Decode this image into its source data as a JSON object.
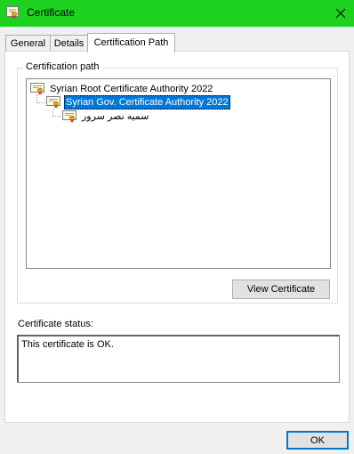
{
  "window": {
    "title": "Certificate",
    "title_bar_color": "#1fd21f",
    "icons": {
      "app": "certificate-icon",
      "close": "close-icon"
    }
  },
  "tabs": [
    {
      "label": "General",
      "active": false
    },
    {
      "label": "Details",
      "active": false
    },
    {
      "label": "Certification Path",
      "active": true
    }
  ],
  "certification_path": {
    "group_label": "Certification path",
    "nodes": [
      {
        "label": "Syrian Root Certificate Authority 2022",
        "level": 0,
        "selected": false,
        "icon": "certificate-icon"
      },
      {
        "label": "Syrian Gov. Certificate Authority 2022",
        "level": 1,
        "selected": true,
        "icon": "certificate-icon"
      },
      {
        "label": "سميه نصر سرور",
        "level": 2,
        "selected": false,
        "icon": "certificate-icon"
      }
    ],
    "view_button": "View Certificate"
  },
  "status": {
    "label": "Certificate status:",
    "text": "This certificate is OK."
  },
  "footer": {
    "ok_button": "OK"
  },
  "colors": {
    "selection": "#0078d7",
    "accent_border": "#0078d7"
  }
}
